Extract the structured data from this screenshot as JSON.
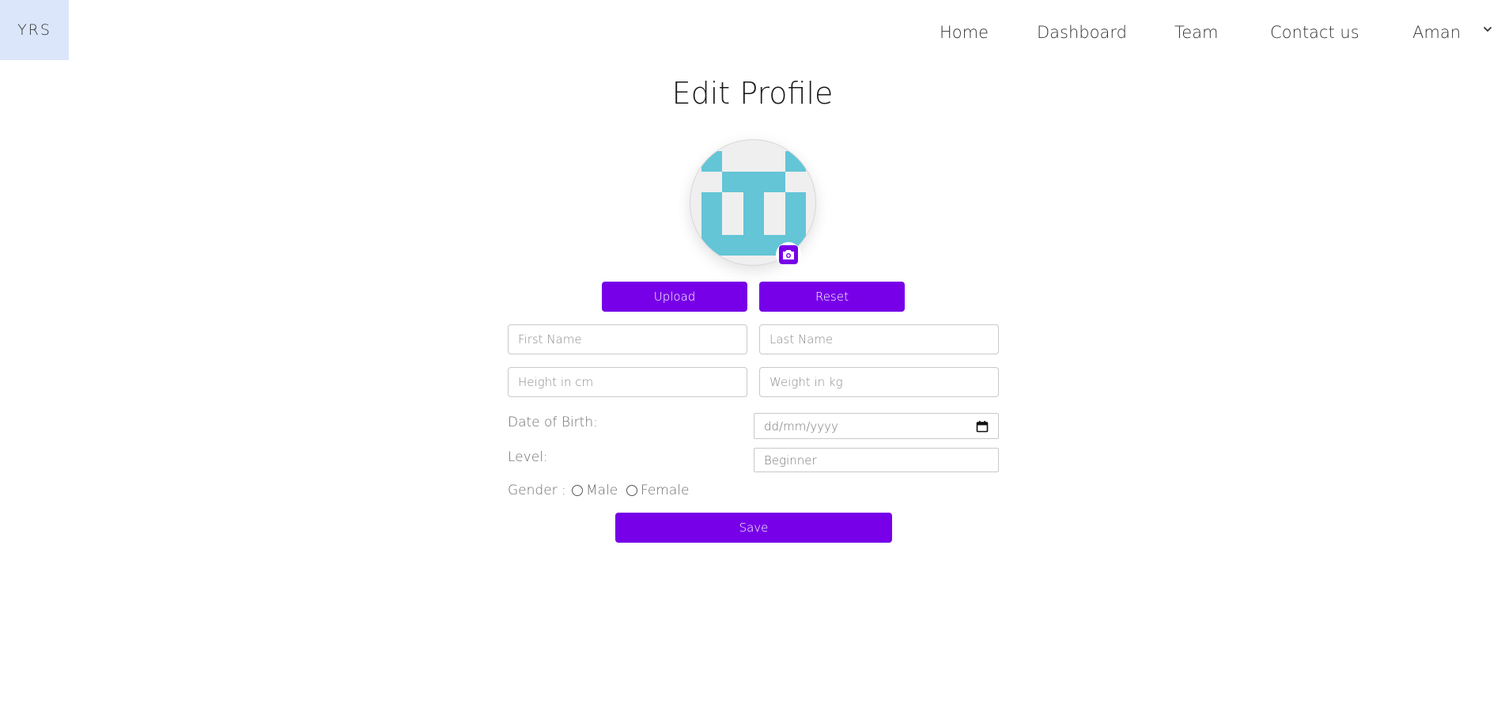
{
  "brand": {
    "logo_text": "YRS",
    "logo_bg": "#dbe6fb"
  },
  "nav": {
    "items": [
      {
        "label": "Home"
      },
      {
        "label": "Dashboard"
      },
      {
        "label": "Team"
      },
      {
        "label": "Contact us"
      }
    ],
    "user": {
      "name": "Aman",
      "icon": "chevron-down-icon"
    }
  },
  "page": {
    "title": "Edit Profile"
  },
  "avatar": {
    "icon": "camera-icon",
    "pattern_color": "#63c5d6"
  },
  "buttons": {
    "upload_label": "Upload",
    "reset_label": "Reset",
    "save_label": "Save",
    "accent": "#7700e8"
  },
  "form": {
    "first_name_placeholder": "First Name",
    "last_name_placeholder": "Last Name",
    "height_placeholder": "Height in cm",
    "weight_placeholder": "Weight in kg",
    "dob_label": "Date of Birth:",
    "dob_placeholder": "dd/mm/yyyy",
    "level_label": "Level:",
    "level_value": "Beginner",
    "gender_label": "Gender :",
    "gender_options": [
      "Male",
      "Female"
    ]
  }
}
